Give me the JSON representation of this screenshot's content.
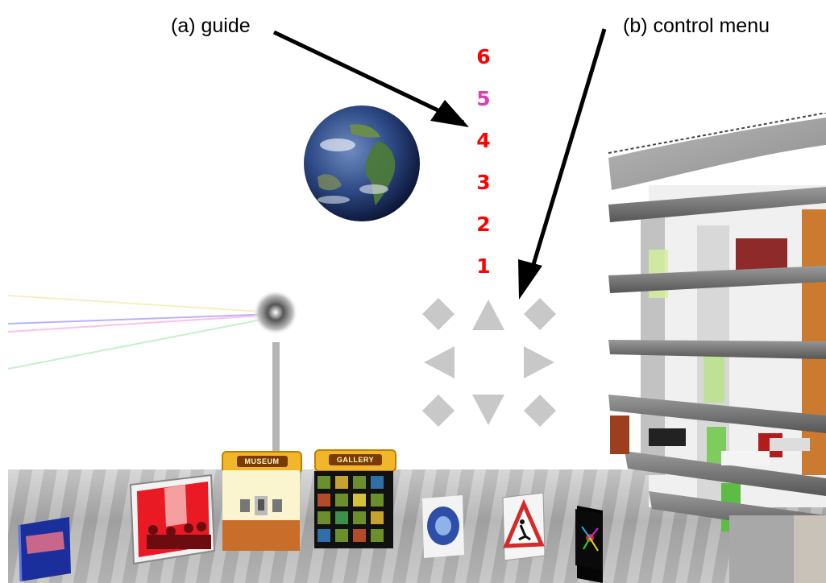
{
  "callouts": {
    "guide": "(a) guide",
    "control_menu": "(b) control menu"
  },
  "floors": [
    {
      "label": "6",
      "color": "#ff0000"
    },
    {
      "label": "5",
      "color": "#dd3fb5"
    },
    {
      "label": "4",
      "color": "#ff0000"
    },
    {
      "label": "3",
      "color": "#ff0000"
    },
    {
      "label": "2",
      "color": "#ff0000"
    },
    {
      "label": "1",
      "color": "#ff0000"
    }
  ],
  "control_menu": {
    "color": "#c8c8c8",
    "buttons": [
      "up-left",
      "up",
      "up-right",
      "left",
      "right",
      "down-left",
      "down",
      "down-right"
    ]
  },
  "exhibit_tags": {
    "museum": "MUSEUM",
    "gallery": "GALLERY"
  },
  "icons": [
    "globe-icon",
    "beacon-icon",
    "building-icon",
    "floor-selector"
  ]
}
